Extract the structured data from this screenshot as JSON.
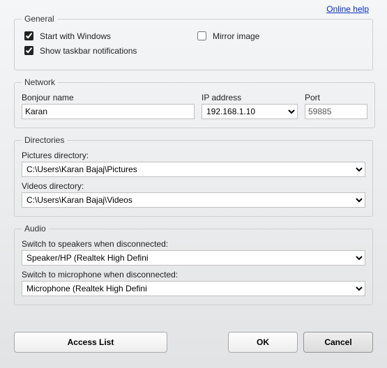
{
  "help_link": "Online help",
  "general": {
    "legend": "General",
    "start_with_windows": {
      "label": "Start with Windows",
      "checked": true
    },
    "mirror_image": {
      "label": "Mirror image",
      "checked": false
    },
    "taskbar_notifications": {
      "label": "Show taskbar notifications",
      "checked": true
    }
  },
  "network": {
    "legend": "Network",
    "bonjour_label": "Bonjour name",
    "bonjour_value": "Karan",
    "ip_label": "IP address",
    "ip_value": "192.168.1.10",
    "port_label": "Port",
    "port_value": "59885"
  },
  "directories": {
    "legend": "Directories",
    "pictures_label": "Pictures directory:",
    "pictures_value": "C:\\Users\\Karan Bajaj\\Pictures",
    "videos_label": "Videos directory:",
    "videos_value": "C:\\Users\\Karan Bajaj\\Videos"
  },
  "audio": {
    "legend": "Audio",
    "speakers_label": "Switch to speakers when disconnected:",
    "speakers_value": "Speaker/HP (Realtek High Defini",
    "mic_label": "Switch to microphone when disconnected:",
    "mic_value": "Microphone (Realtek High Defini"
  },
  "buttons": {
    "access_list": "Access List",
    "ok": "OK",
    "cancel": "Cancel"
  }
}
